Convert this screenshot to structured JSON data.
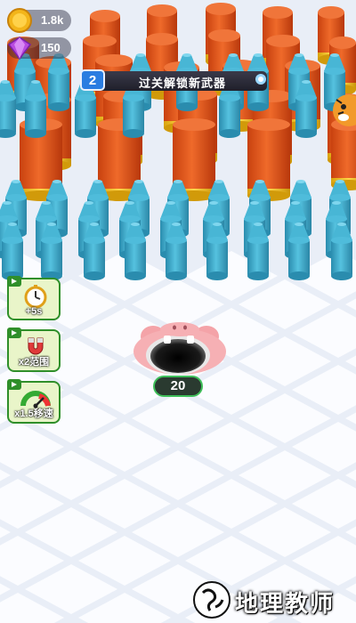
{
  "hud": {
    "coins": "1.8k",
    "gems": "150"
  },
  "level": {
    "number": "2",
    "unlock_text": "过关解锁新武器"
  },
  "boosts": [
    {
      "label": "+5s",
      "icon": "stopwatch-icon"
    },
    {
      "label": "x2范围",
      "icon": "magnet-icon"
    },
    {
      "label": "x1.5移速",
      "icon": "speedometer-icon"
    }
  ],
  "hole": {
    "count": "20",
    "character": "pig-hole"
  },
  "watermark": {
    "text": "地理教师"
  },
  "colors": {
    "cylinder_orange": "#e8561c",
    "cylinder_gold": "#f2c21a",
    "crayon_blue": "#3aa8c8",
    "pig_pink": "#f4a3a8",
    "badge_blue": "#2a7de1",
    "boost_green": "#2f8f2a"
  }
}
